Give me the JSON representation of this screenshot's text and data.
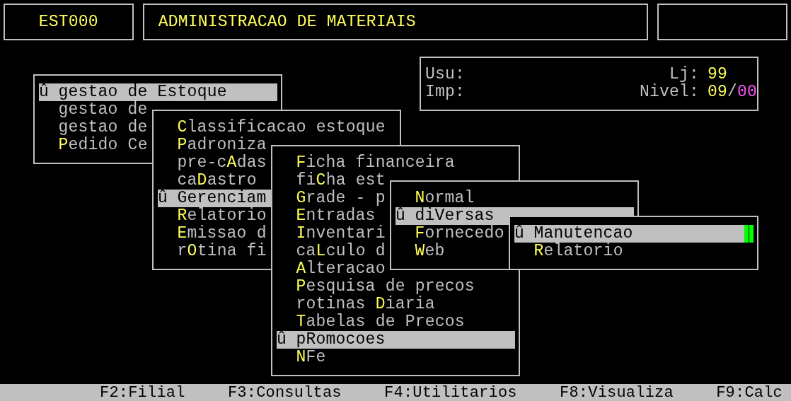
{
  "header": {
    "code": "EST000",
    "title": "ADMINISTRACAO DE MATERIAIS"
  },
  "info": {
    "user_label": "Usu:",
    "printer_label": "Imp:",
    "store_label": "Lj:",
    "store": "99",
    "level_label": "Nivel:",
    "level_value": "09",
    "level_separator": "/",
    "level_max": "00"
  },
  "menus": [
    {
      "items": [
        {
          "marker": "û",
          "text": "gestao de Estoque",
          "selected": true
        },
        {
          "text": "gestao de",
          "selected": false
        },
        {
          "text": "gestao de",
          "selected": false
        },
        {
          "hotkey": "P",
          "after": "edido Ce",
          "selected": false
        }
      ]
    },
    {
      "items": [
        {
          "hotkey": "C",
          "after": "lassificacao estoque",
          "selected": false
        },
        {
          "hotkey": "P",
          "after": "adroniza",
          "selected": false
        },
        {
          "before": "pre-c",
          "hotkey": "A",
          "after": "das",
          "selected": false
        },
        {
          "before": "ca",
          "hotkey": "D",
          "after": "astro",
          "selected": false
        },
        {
          "marker": "û",
          "text": "Gerenciam",
          "selected": true
        },
        {
          "hotkey": "R",
          "after": "elatorio",
          "selected": false
        },
        {
          "hotkey": "E",
          "after": "missao d",
          "selected": false
        },
        {
          "before": "r",
          "hotkey": "O",
          "after": "tina fi",
          "selected": false
        }
      ]
    },
    {
      "items": [
        {
          "hotkey": "F",
          "after": "icha financeira",
          "selected": false
        },
        {
          "before": "fi",
          "hotkey": "C",
          "after": "ha est",
          "selected": false
        },
        {
          "hotkey": "G",
          "after": "rade - p",
          "selected": false
        },
        {
          "hotkey": "E",
          "after": "ntradas",
          "selected": false
        },
        {
          "hotkey": "I",
          "after": "nventari",
          "selected": false
        },
        {
          "before": "ca",
          "hotkey": "L",
          "after": "culo d",
          "selected": false
        },
        {
          "hotkey": "A",
          "after": "lteracao",
          "selected": false
        },
        {
          "hotkey": "P",
          "after": "esquisa de precos",
          "selected": false
        },
        {
          "before": "rotinas ",
          "hotkey": "D",
          "after": "iaria",
          "selected": false
        },
        {
          "hotkey": "T",
          "after": "abelas de Precos",
          "selected": false
        },
        {
          "marker": "û",
          "text": "pRomocoes",
          "selected": true
        },
        {
          "hotkey": "N",
          "after": "Fe",
          "selected": false
        }
      ]
    },
    {
      "items": [
        {
          "hotkey": "N",
          "after": "ormal",
          "selected": false
        },
        {
          "marker": "û",
          "text": "diVersas",
          "selected": true
        },
        {
          "hotkey": "F",
          "after": "ornecedo",
          "selected": false
        },
        {
          "hotkey": "W",
          "after": "eb",
          "selected": false
        }
      ]
    },
    {
      "items": [
        {
          "marker": "û",
          "text": "Manutencao",
          "selected": true
        },
        {
          "hotkey": "R",
          "after": "elatorio",
          "selected": false
        }
      ]
    }
  ],
  "function_keys": [
    "F2:Filial",
    "F3:Consultas",
    "F4:Utilitarios",
    "F8:Visualiza",
    "F9:Calc"
  ]
}
